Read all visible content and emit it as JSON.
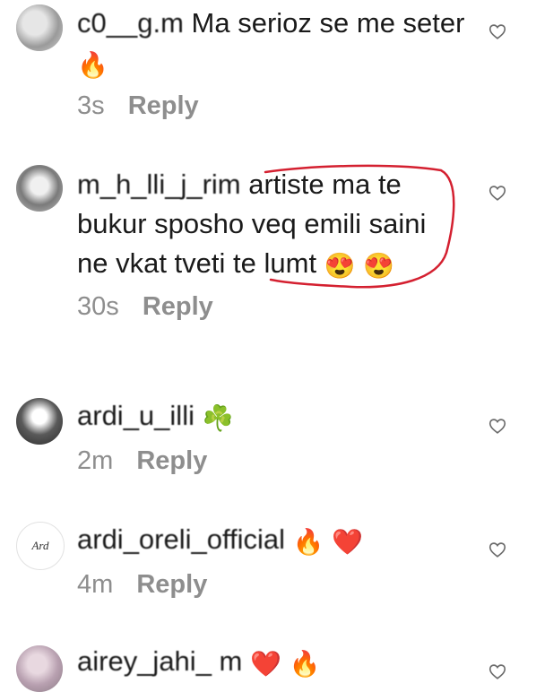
{
  "comments": [
    {
      "username": "c0__g.m",
      "text": "Ma serioz se me seter",
      "emojis": [
        "🔥"
      ],
      "time": "3s",
      "reply_label": "Reply",
      "like_icon": "heart-outline-icon"
    },
    {
      "username": "m_h_lli_j_rim",
      "text": "artiste ma te bukur sposho veq emili saini ne vkat tveti te lumt",
      "emojis": [
        "😍",
        "😍"
      ],
      "time": "30s",
      "reply_label": "Reply",
      "like_icon": "heart-outline-icon",
      "annotation_color": "#d42030"
    },
    {
      "username": "ardi_u_illi",
      "text": "",
      "emojis": [
        "☘️"
      ],
      "time": "2m",
      "reply_label": "Reply",
      "like_icon": "heart-outline-icon"
    },
    {
      "username": "ardi_oreli_official",
      "avatar_text": "Ard",
      "text": "",
      "emojis": [
        "🔥",
        "❤️"
      ],
      "time": "4m",
      "reply_label": "Reply",
      "like_icon": "heart-outline-icon"
    },
    {
      "username": "airey_jahi_ m",
      "text": "",
      "emojis": [
        "❤️",
        "🔥"
      ],
      "time": "",
      "reply_label": "",
      "like_icon": "heart-outline-icon"
    }
  ],
  "colors": {
    "text": "#1a1a1a",
    "meta": "#8e8e8e",
    "annotation": "#d42030"
  }
}
